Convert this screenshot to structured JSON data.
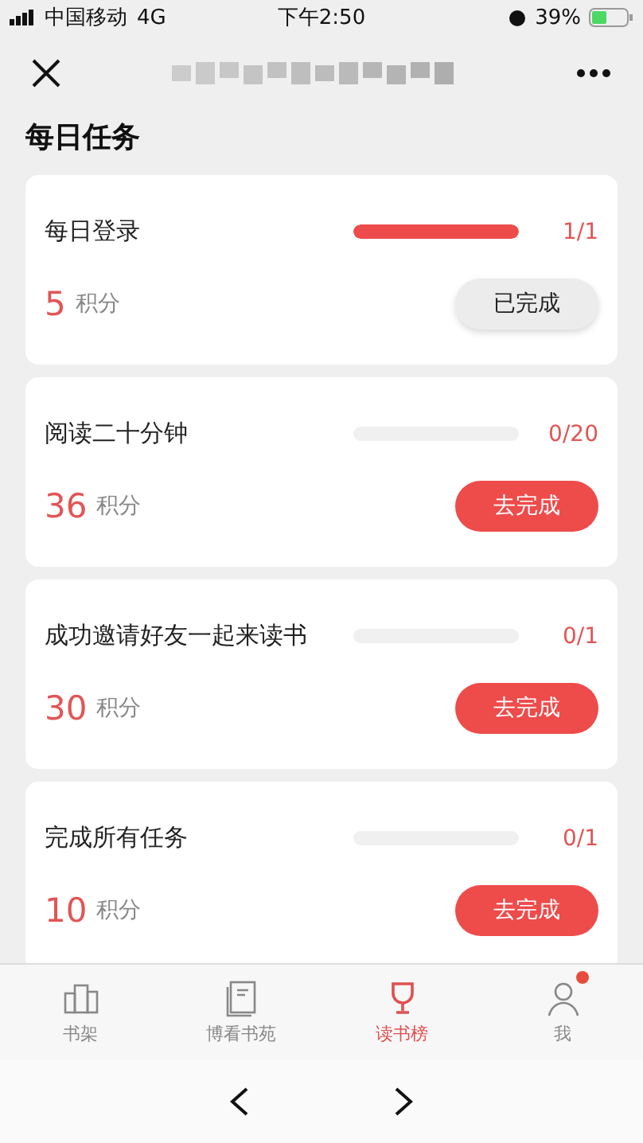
{
  "status_bar": {
    "carrier": "中国移动",
    "network": "4G",
    "time": "下午2:50",
    "battery": "39%"
  },
  "section_title": "每日任务",
  "tasks": [
    {
      "name": "每日登录",
      "level": 1,
      "count": "1/1",
      "points": "5",
      "unit": "积分",
      "button": "已完成",
      "done": true
    },
    {
      "name": "阅读二十分钟",
      "level": 0,
      "count": "0/20",
      "points": "36",
      "unit": "积分",
      "button": "去完成",
      "done": false
    },
    {
      "name": "成功邀请好友一起来读书",
      "level": 0,
      "count": "0/1",
      "points": "30",
      "unit": "积分",
      "button": "去完成",
      "done": false
    },
    {
      "name": "完成所有任务",
      "level": 0,
      "count": "0/1",
      "points": "10",
      "unit": "积分",
      "button": "去完成",
      "done": false
    }
  ],
  "tab_bar": [
    {
      "label": "书架",
      "selected": false,
      "badge": false
    },
    {
      "label": "博看书苑",
      "selected": false,
      "badge": false
    },
    {
      "label": "读书榜",
      "selected": true,
      "badge": false
    },
    {
      "label": "我",
      "selected": false,
      "badge": true
    }
  ]
}
